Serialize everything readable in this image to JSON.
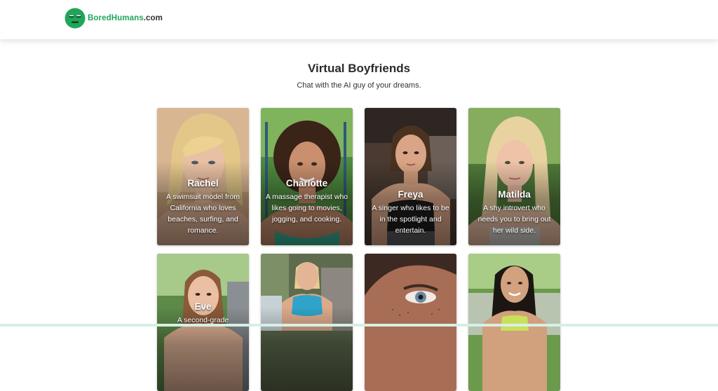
{
  "header": {
    "logo_brand": "BoredHumans",
    "logo_tld": ".com"
  },
  "page": {
    "title": "Virtual Boyfriends",
    "subtitle": "Chat with the AI guy of your dreams."
  },
  "cards": [
    {
      "name": "Rachel",
      "desc": "A swimsuit model from California who loves beaches, surfing, and romance."
    },
    {
      "name": "Charlotte",
      "desc": "A massage therapist who likes going to movies, jogging, and cooking."
    },
    {
      "name": "Freya",
      "desc": "A singer who likes to be in the spotlight and entertain."
    },
    {
      "name": "Matilda",
      "desc": "A shy introvert who needs you to bring out her wild side."
    },
    {
      "name": "Eve",
      "desc": "A second-grade"
    },
    {
      "name": "",
      "desc": ""
    },
    {
      "name": "",
      "desc": ""
    },
    {
      "name": "",
      "desc": ""
    }
  ],
  "colors": {
    "brand_green": "#1fa65a",
    "header_bg": "#ffffff"
  },
  "icons": {
    "logo": "bored-face-icon"
  }
}
